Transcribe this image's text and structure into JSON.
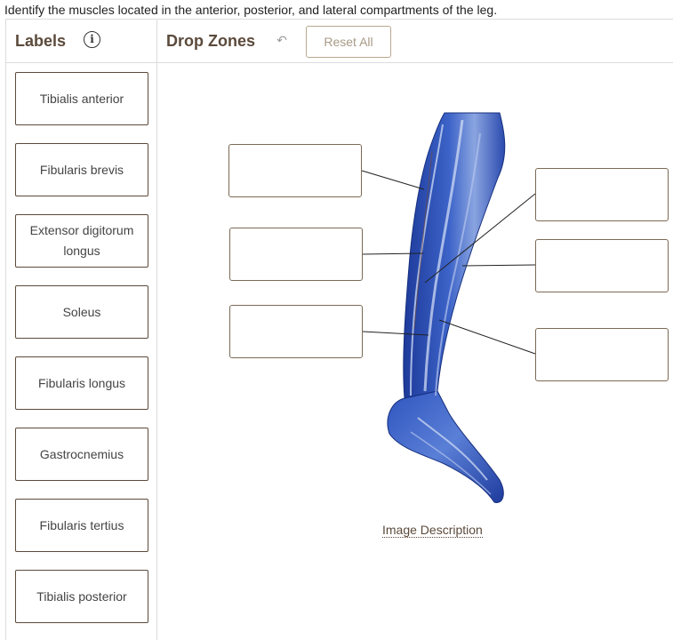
{
  "question": "Identify the muscles located in the anterior, posterior, and lateral compartments of the leg.",
  "labels_panel": {
    "title": "Labels",
    "info_icon": "info-icon",
    "items": [
      "Tibialis anterior",
      "Fibularis brevis",
      "Extensor digitorum longus",
      "Soleus",
      "Fibularis longus",
      "Gastrocnemius",
      "Fibularis tertius",
      "Tibialis posterior"
    ]
  },
  "drop_panel": {
    "title": "Drop Zones",
    "undo_icon": "undo-icon",
    "reset_label": "Reset All",
    "image_description": "Image Description"
  },
  "colors": {
    "brand_text": "#5b4a3b",
    "card_border": "#5b4a3b",
    "reset_border": "#b8a98f",
    "divider": "#dcdcdc",
    "muscle_blue": "#2f4fb0"
  }
}
